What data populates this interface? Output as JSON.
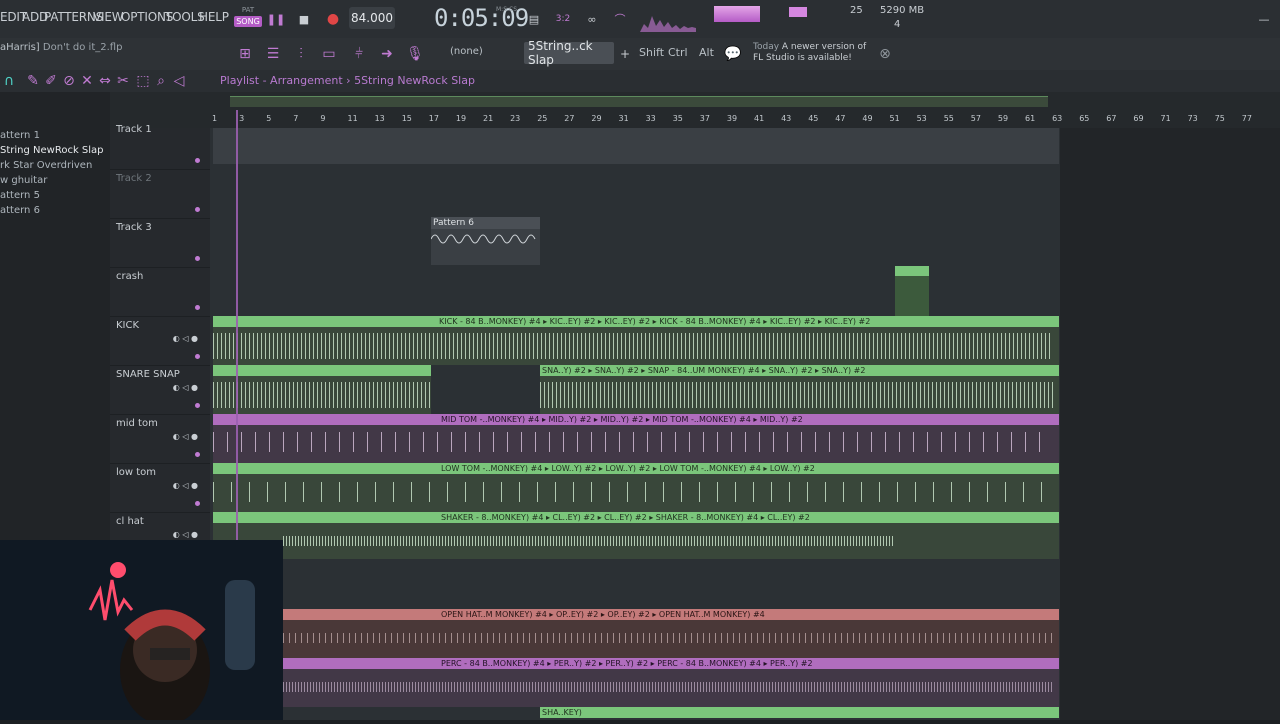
{
  "menu": {
    "items": [
      "EDIT",
      "ADD",
      "PATTERNS",
      "VIEW",
      "OPTIONS",
      "TOOLS",
      "HELP"
    ]
  },
  "transport": {
    "pat_label": "PAT",
    "song_label": "SONG",
    "tempo": "84.000",
    "time": "0:05:09",
    "time_unit": "M:S:CS"
  },
  "monitor": {
    "cpu": "25",
    "memory": "5290 MB",
    "voices": "4"
  },
  "file": {
    "user": "aHarris]",
    "name": "Don't do it_2.flp"
  },
  "toolbar": {
    "preset": "(none)",
    "pattern_selector": "5String..ck Slap",
    "shift": "Shift",
    "ctrl": "Ctrl",
    "alt": "Alt",
    "news_date": "Today",
    "news_text_1": "A newer version of",
    "news_text_2": "FL Studio is available!"
  },
  "playlist": {
    "title": "Playlist - Arrangement",
    "separator": "›",
    "pattern": "5String NewRock Slap"
  },
  "browser": {
    "items": [
      "attern 1",
      "String NewRock Slap",
      "rk Star Overdriven",
      "w ghuitar",
      "attern 5",
      "attern 6"
    ]
  },
  "ruler": {
    "bars": [
      "1",
      "3",
      "5",
      "7",
      "9",
      "11",
      "13",
      "15",
      "17",
      "19",
      "21",
      "23",
      "25",
      "27",
      "29",
      "31",
      "33",
      "35",
      "37",
      "39",
      "41",
      "43",
      "45",
      "47",
      "49",
      "51",
      "53",
      "55",
      "57",
      "59",
      "61",
      "63",
      "65",
      "67",
      "69",
      "71",
      "73",
      "75",
      "77"
    ]
  },
  "tracks": [
    {
      "name": "Track 1",
      "dim": false
    },
    {
      "name": "Track 2",
      "dim": true
    },
    {
      "name": "Track 3",
      "dim": false
    },
    {
      "name": "crash",
      "dim": false
    },
    {
      "name": "KICK",
      "dim": false
    },
    {
      "name": "SNARE SNAP",
      "dim": false
    },
    {
      "name": "mid tom",
      "dim": false
    },
    {
      "name": "low tom",
      "dim": false
    },
    {
      "name": "cl hat",
      "dim": false
    }
  ],
  "clips": {
    "pattern6": "Pattern 6",
    "kick": "KICK - 84 B..MONKEY) #4 ▸ KIC..EY) #2 ▸ KIC..EY) #2 ▸ KICK - 84 B..MONKEY) #4 ▸ KIC..EY) #2 ▸ KIC..EY) #2",
    "snare_a": "SNA..Y) #2 ▸ SNA..Y) #2 ▸ SNAP - 84..UM MONKEY) #4 ▸ SNA..Y) #2 ▸ SNA..Y) #2",
    "midtom": "MID TOM -..MONKEY) #4 ▸ MID..Y) #2 ▸ MID..Y) #2 ▸ MID TOM -..MONKEY) #4 ▸ MID..Y) #2",
    "lowtom": "LOW TOM -..MONKEY) #4 ▸ LOW..Y) #2 ▸ LOW..Y) #2 ▸ LOW TOM -..MONKEY) #4 ▸ LOW..Y) #2",
    "hat": "SHAKER - 8..MONKEY) #4 ▸ CL..EY) #2 ▸ CL..EY) #2 ▸ SHAKER - 8..MONKEY) #4 ▸ CL..EY) #2",
    "openhat": "OPEN HAT..M MONKEY) #4 ▸ OP..EY) #2 ▸ OP..EY) #2 ▸ OPEN HAT..M MONKEY) #4",
    "perc": "PERC - 84 B..MONKEY) #4 ▸ PER..Y) #2 ▸ PER..Y) #2 ▸ PERC - 84 B..MONKEY) #4 ▸ PER..Y) #2",
    "shaker": "SHA..KEY)"
  },
  "colors": {
    "accent": "#b45cc6",
    "green": "#7bc67b",
    "pink": "#c47a7a",
    "purple": "#b06dbe"
  }
}
